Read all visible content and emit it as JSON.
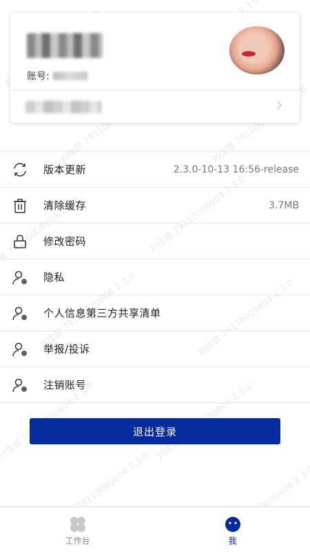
{
  "profile": {
    "account_label": "账号:"
  },
  "menu": [
    {
      "label": "版本更新",
      "value": "2.3.0-10-13 16:56-release",
      "icon": "sync-icon"
    },
    {
      "label": "清除缓存",
      "value": "3.7MB",
      "icon": "trash-icon"
    },
    {
      "label": "修改密码",
      "value": "",
      "icon": "lock-icon"
    },
    {
      "label": "隐私",
      "value": "",
      "icon": "user-settings-icon"
    },
    {
      "label": "个人信息第三方共享清单",
      "value": "",
      "icon": "user-settings-icon"
    },
    {
      "label": "举报/投诉",
      "value": "",
      "icon": "user-settings-icon"
    },
    {
      "label": "注销账号",
      "value": "",
      "icon": "user-settings-icon"
    }
  ],
  "logout_label": "退出登录",
  "tabs": [
    {
      "label": "工作台",
      "icon": "workbench-icon",
      "active": false
    },
    {
      "label": "我",
      "icon": "me-icon",
      "active": true
    }
  ],
  "watermark_text": "刘佳慧 79110000604 2.3.0",
  "colors": {
    "primary": "#062b9e",
    "divider": "#e4e4e4",
    "tab_inactive": "#888888",
    "tab_active": "#062b9e"
  }
}
